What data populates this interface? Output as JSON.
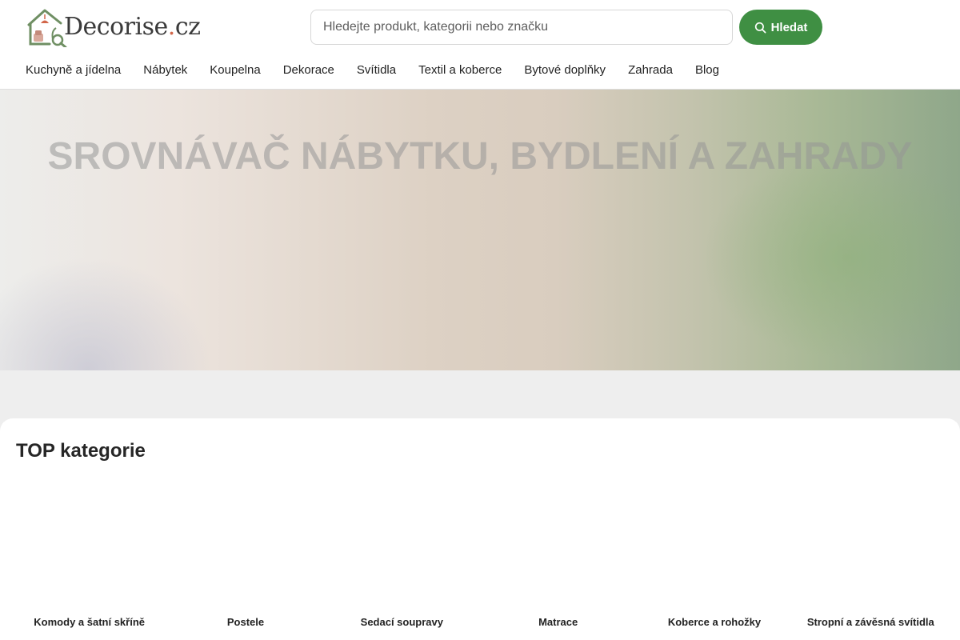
{
  "brand": {
    "name": "Decorise",
    "dot": ".",
    "tld": "cz",
    "colors": {
      "logo_green": "#6f8f63",
      "logo_orange": "#d2674a",
      "text": "#3a3a3a"
    }
  },
  "search": {
    "placeholder": "Hledejte produkt, kategorii nebo značku",
    "value": "",
    "button_label": "Hledat",
    "button_icon": "search-icon",
    "button_color": "#3f8f43"
  },
  "nav": {
    "items": [
      {
        "label": "Kuchyně a jídelna"
      },
      {
        "label": "Nábytek"
      },
      {
        "label": "Koupelna"
      },
      {
        "label": "Dekorace"
      },
      {
        "label": "Svítidla"
      },
      {
        "label": "Textil a koberce"
      },
      {
        "label": "Bytové doplňky"
      },
      {
        "label": "Zahrada"
      },
      {
        "label": "Blog"
      }
    ]
  },
  "hero": {
    "title": "SROVNÁVAČ NÁBYTKU, BYDLENÍ A ZAHRADY"
  },
  "categories": {
    "title": "TOP kategorie",
    "items": [
      {
        "label": "Komody a šatní skříně"
      },
      {
        "label": "Postele"
      },
      {
        "label": "Sedací soupravy"
      },
      {
        "label": "Matrace"
      },
      {
        "label": "Koberce a rohožky"
      },
      {
        "label": "Stropní a závěsná svítidla"
      }
    ]
  }
}
